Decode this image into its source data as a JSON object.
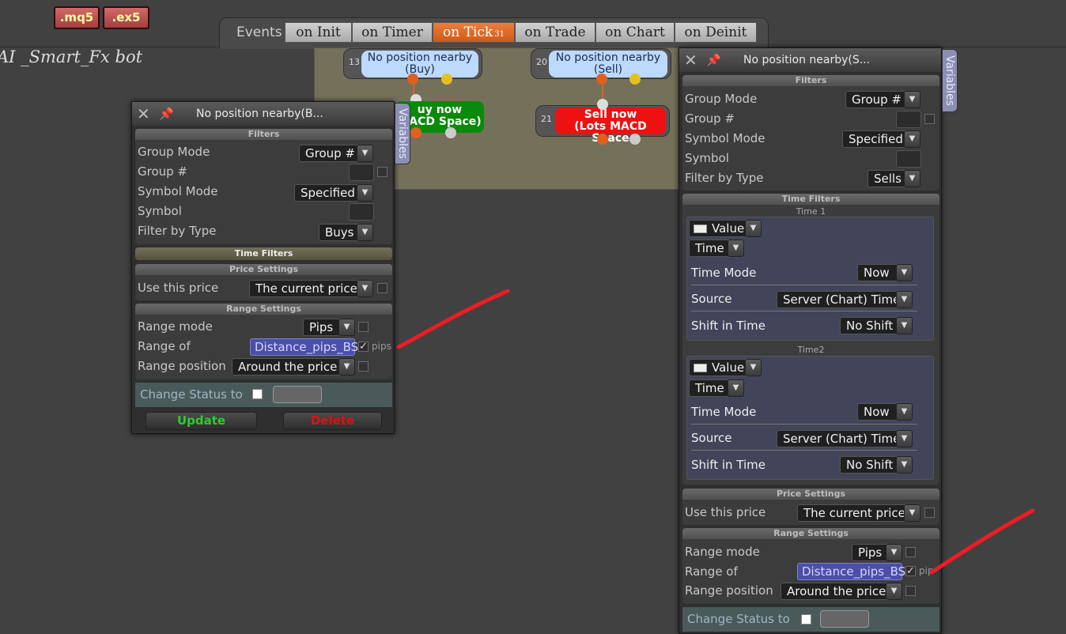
{
  "file_buttons": {
    "mq5": ".mq5",
    "ex5": ".ex5"
  },
  "project_name": "AI _Smart_Fx bot",
  "events": {
    "label": "Events",
    "tabs": [
      {
        "label": "on Init"
      },
      {
        "label": "on Timer"
      },
      {
        "label": "on Tick",
        "badge": "31",
        "active": true
      },
      {
        "label": "on Trade"
      },
      {
        "label": "on Chart"
      },
      {
        "label": "on Deinit"
      }
    ]
  },
  "canvas": {
    "block13": {
      "num": "13",
      "line1": "No position nearby",
      "line2": "(Buy)"
    },
    "block20": {
      "num": "20",
      "line1": "No position nearby",
      "line2": "(Sell)"
    },
    "buy_action": {
      "line1": "uy now",
      "line2": "MACD Space)",
      "color": "#0a8a0a"
    },
    "sell_action": {
      "num": "21",
      "line1": "Sell now",
      "line2": "(Lots MACD Space",
      "color": "#ee1111"
    }
  },
  "left_panel": {
    "title": "No position nearby(B...",
    "variables_tab": "Variables",
    "filters_header": "Filters",
    "group_mode_label": "Group Mode",
    "group_mode_value": "Group #",
    "group_num_label": "Group #",
    "symbol_mode_label": "Symbol Mode",
    "symbol_mode_value": "Specified",
    "symbol_label": "Symbol",
    "filter_type_label": "Filter by Type",
    "filter_type_value": "Buys",
    "time_filters_header": "Time Filters",
    "price_settings_header": "Price Settings",
    "use_price_label": "Use this price",
    "use_price_value": "The current price",
    "range_settings_header": "Range Settings",
    "range_mode_label": "Range mode",
    "range_mode_value": "Pips",
    "range_of_label": "Range of",
    "range_of_value": "Distance_pips_BS",
    "range_unit": "pips",
    "range_pos_label": "Range position",
    "range_pos_value": "Around the price",
    "change_status_label": "Change Status to",
    "update_label": "Update",
    "delete_label": "Delete"
  },
  "right_panel": {
    "title": "No position nearby(S...",
    "variables_tab": "Variables",
    "filters_header": "Filters",
    "group_mode_label": "Group Mode",
    "group_mode_value": "Group #",
    "group_num_label": "Group #",
    "symbol_mode_label": "Symbol Mode",
    "symbol_mode_value": "Specified",
    "symbol_label": "Symbol",
    "filter_type_label": "Filter by Type",
    "filter_type_value": "Sells",
    "time_filters_header": "Time Filters",
    "time1": {
      "label": "Time 1",
      "value_type": "Value",
      "kind": "Time",
      "time_mode_label": "Time Mode",
      "time_mode_value": "Now",
      "source_label": "Source",
      "source_value": "Server (Chart) Time",
      "shift_label": "Shift in Time",
      "shift_value": "No Shift"
    },
    "time2": {
      "label": "Time2",
      "value_type": "Value",
      "kind": "Time",
      "time_mode_label": "Time Mode",
      "time_mode_value": "Now",
      "source_label": "Source",
      "source_value": "Server (Chart) Time",
      "shift_label": "Shift in Time",
      "shift_value": "No Shift"
    },
    "price_settings_header": "Price Settings",
    "use_price_label": "Use this price",
    "use_price_value": "The current price",
    "range_settings_header": "Range Settings",
    "range_mode_label": "Range mode",
    "range_mode_value": "Pips",
    "range_of_label": "Range of",
    "range_of_value": "Distance_pips_BS",
    "range_unit": "pip",
    "range_pos_label": "Range position",
    "range_pos_value": "Around the price",
    "change_status_label": "Change Status to"
  },
  "colors": {
    "accent_tab": "#e06a28",
    "annotation": "#ee1c24",
    "update": "#2ecc2e",
    "delete": "#dd1111"
  }
}
